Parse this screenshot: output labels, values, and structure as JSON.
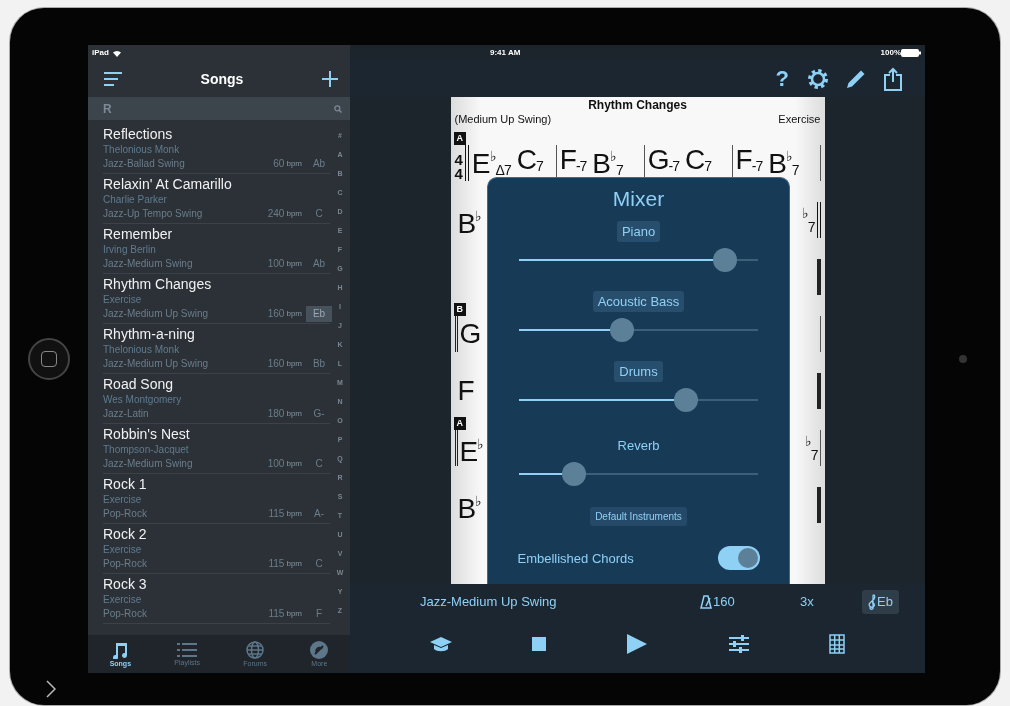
{
  "status_bar": {
    "device": "iPad",
    "time": "9:41 AM",
    "battery": "100%"
  },
  "songs_panel": {
    "title": "Songs",
    "section": "R",
    "index": [
      "#",
      "A",
      "B",
      "C",
      "D",
      "E",
      "F",
      "G",
      "H",
      "I",
      "J",
      "K",
      "L",
      "M",
      "N",
      "O",
      "P",
      "Q",
      "R",
      "S",
      "T",
      "U",
      "V",
      "W",
      "Y",
      "Z"
    ],
    "songs": [
      {
        "title": "Reflections",
        "artist": "Thelonious Monk",
        "style": "Jazz-Ballad Swing",
        "bpm": "60",
        "unit": "bpm",
        "key": "Ab",
        "selected": false
      },
      {
        "title": "Relaxin' At Camarillo",
        "artist": "Charlie Parker",
        "style": "Jazz-Up Tempo Swing",
        "bpm": "240",
        "unit": "bpm",
        "key": "C",
        "selected": false
      },
      {
        "title": "Remember",
        "artist": "Irving Berlin",
        "style": "Jazz-Medium Swing",
        "bpm": "100",
        "unit": "bpm",
        "key": "Ab",
        "selected": false
      },
      {
        "title": "Rhythm Changes",
        "artist": "Exercise",
        "style": "Jazz-Medium Up Swing",
        "bpm": "160",
        "unit": "bpm",
        "key": "Eb",
        "selected": true
      },
      {
        "title": "Rhythm-a-ning",
        "artist": "Thelonious Monk",
        "style": "Jazz-Medium Up Swing",
        "bpm": "160",
        "unit": "bpm",
        "key": "Bb",
        "selected": false
      },
      {
        "title": "Road Song",
        "artist": "Wes Montgomery",
        "style": "Jazz-Latin",
        "bpm": "180",
        "unit": "bpm",
        "key": "G-",
        "selected": false
      },
      {
        "title": "Robbin's Nest",
        "artist": "Thompson-Jacquet",
        "style": "Jazz-Medium Swing",
        "bpm": "100",
        "unit": "bpm",
        "key": "C",
        "selected": false
      },
      {
        "title": "Rock 1",
        "artist": "Exercise",
        "style": "Pop-Rock",
        "bpm": "115",
        "unit": "bpm",
        "key": "A-",
        "selected": false
      },
      {
        "title": "Rock 2",
        "artist": "Exercise",
        "style": "Pop-Rock",
        "bpm": "115",
        "unit": "bpm",
        "key": "C",
        "selected": false
      },
      {
        "title": "Rock 3",
        "artist": "Exercise",
        "style": "Pop-Rock",
        "bpm": "115",
        "unit": "bpm",
        "key": "F",
        "selected": false
      }
    ],
    "tabs": [
      {
        "kind": "songs",
        "label": "Songs",
        "selected": true
      },
      {
        "kind": "playlists",
        "label": "Playlists",
        "selected": false
      },
      {
        "kind": "forums",
        "label": "Forums",
        "selected": false
      },
      {
        "kind": "more",
        "label": "More",
        "selected": false
      }
    ]
  },
  "toolbar": {
    "help": "?"
  },
  "sheet": {
    "title": "Rhythm Changes",
    "style": "(Medium Up Swing)",
    "composer": "Exercise",
    "rows": [
      {
        "kind": "full",
        "section": "A",
        "time_signature": [
          "4",
          "4"
        ],
        "repeat_start": true,
        "double_start": false,
        "repeat_end": false,
        "thick_end": false,
        "measures": [
          [
            "E$^{♭}$$_{Δ7}$",
            "C$_{7}$"
          ],
          [
            "F$_{-7}$",
            "B$^{♭}$$_{7}$"
          ],
          [
            "G$_{-7}$",
            "C$_{7}$"
          ],
          [
            "F$_{-7}$",
            "B$^{♭}$$_{7}$"
          ]
        ]
      },
      {
        "kind": "covered",
        "repeat_start": false,
        "double_start": false,
        "repeat_end": true,
        "thick_end": false,
        "first_chord": "B$^{♭}$",
        "last_chord": "$^{♭}$$_{7}$"
      },
      {
        "kind": "covered",
        "repeat_start": false,
        "double_start": false,
        "repeat_end": false,
        "thick_end": true
      },
      {
        "kind": "covered",
        "section": "B",
        "repeat_start": false,
        "double_start": true,
        "repeat_end": false,
        "thick_end": false,
        "first_chord": "G"
      },
      {
        "kind": "covered",
        "repeat_start": false,
        "double_start": false,
        "repeat_end": false,
        "thick_end": true,
        "first_chord": "F"
      },
      {
        "kind": "covered",
        "section": "A",
        "repeat_start": false,
        "double_start": true,
        "repeat_end": false,
        "thick_end": false,
        "first_chord": "E$^{♭}$",
        "last_chord": "$^{♭}$$_{7}$"
      },
      {
        "kind": "covered",
        "repeat_start": false,
        "double_start": false,
        "repeat_end": false,
        "thick_end": true,
        "first_chord": "B$^{♭}$"
      }
    ]
  },
  "mixer": {
    "title": "Mixer",
    "channels": [
      {
        "kind": "instrument",
        "name": "Piano",
        "level": 0.86
      },
      {
        "kind": "instrument",
        "name": "Acoustic Bass",
        "level": 0.43
      },
      {
        "kind": "instrument",
        "name": "Drums",
        "level": 0.7
      },
      {
        "kind": "effect",
        "name": "Reverb",
        "level": 0.23
      }
    ],
    "reset_button": "Default Instruments",
    "toggle": {
      "label": "Embellished Chords",
      "on": true
    }
  },
  "player": {
    "style": "Jazz-Medium Up Swing",
    "tempo": "160",
    "repeats": "3x",
    "key": "Eb"
  }
}
